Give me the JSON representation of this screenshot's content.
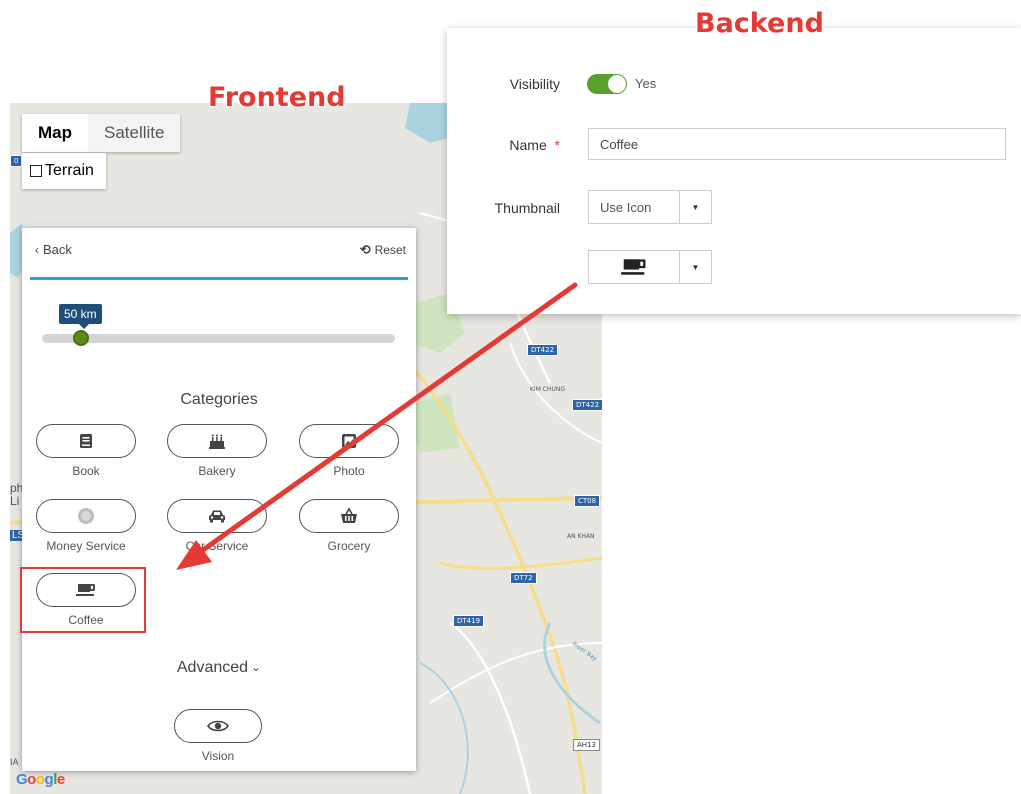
{
  "annotations": {
    "frontend": "Frontend",
    "backend": "Backend"
  },
  "map": {
    "type_buttons": [
      "Map",
      "Satellite"
    ],
    "terrain_label": "Terrain",
    "road_labels": [
      "DT422",
      "DT422",
      "CT08",
      "DT72",
      "DT419",
      "AH13",
      "0"
    ],
    "place_labels": [
      "KIM CHUNG",
      "AN KHÁN",
      "River Bay"
    ],
    "edge_label": "ph\nLi",
    "edge_label_2": "LS",
    "edge_label_3": "IA",
    "google_logo": "Google"
  },
  "frontend": {
    "back_label": "Back",
    "reset_label": "Reset",
    "radius_label": "50 km",
    "radius_fraction": 0.11,
    "categories_title": "Categories",
    "categories": [
      {
        "label": "Book",
        "icon": "book-icon"
      },
      {
        "label": "Bakery",
        "icon": "cake-icon"
      },
      {
        "label": "Photo",
        "icon": "photo-icon"
      },
      {
        "label": "Money Service",
        "icon": "coin-icon"
      },
      {
        "label": "Car Service",
        "icon": "car-icon"
      },
      {
        "label": "Grocery",
        "icon": "basket-icon"
      },
      {
        "label": "Coffee",
        "icon": "coffee-icon"
      }
    ],
    "advanced_label": "Advanced",
    "vision_label": "Vision"
  },
  "backend": {
    "visibility_label": "Visibility",
    "visibility_value": "Yes",
    "name_label": "Name",
    "name_required_mark": "*",
    "name_value": "Coffee",
    "thumbnail_label": "Thumbnail",
    "thumbnail_value": "Use Icon",
    "icon_value": "coffee-icon"
  },
  "colors": {
    "accent": "#2a9fc9",
    "toggle_on": "#5aa02c",
    "annotation": "#e53935",
    "tooltip": "#1f4e79"
  }
}
